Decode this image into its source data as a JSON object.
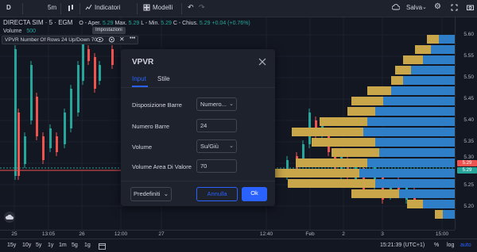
{
  "topbar": {
    "logo": "D",
    "interval": "5m",
    "indicators_label": "Indicatori",
    "templates_label": "Modelli",
    "save_label": "Salva"
  },
  "legend": {
    "symbol": "DIRECTA SIM · 5 · EGM",
    "open_label": "O - Aper.",
    "open_value": "5.29",
    "high_label": "Max.",
    "high_value": "5.29",
    "low_label": "L - Min.",
    "low_value": "5.29",
    "close_label": "C - Chius.",
    "close_value": "5.29",
    "change": "+0.04 (+0.76%)",
    "volume_label": "Volume",
    "volume_value": "500"
  },
  "indicator": {
    "text": "VPVR Number Of Rows 24 Up/Down 70",
    "tooltip": "Impostazioni"
  },
  "dialog": {
    "title": "VPVR",
    "tabs": [
      "Input",
      "Stile"
    ],
    "rows": [
      {
        "label": "Disposizione Barre",
        "value": "Numero..."
      },
      {
        "label": "Numero Barre",
        "value": "24"
      },
      {
        "label": "Volume",
        "value": "Su/Giù"
      },
      {
        "label": "Volume Area Di Valore",
        "value": "70"
      }
    ],
    "defaults_label": "Predefiniti",
    "cancel_label": "Annulla",
    "ok_label": "Ok"
  },
  "price_axis": {
    "labels": [
      "5.60",
      "5.55",
      "5.50",
      "5.45",
      "5.40",
      "5.35",
      "5.30",
      "5.25",
      "5.20"
    ],
    "badge_1": "5.29",
    "badge_2": "5.29"
  },
  "time_axis": {
    "labels": [
      "25",
      "13:05",
      "26",
      "12:00",
      "27",
      "12:40",
      "Feb",
      "2",
      "3",
      "15:00"
    ]
  },
  "bottom_bar": {
    "ranges": [
      "15y",
      "10y",
      "5y",
      "1y",
      "1m",
      "5g",
      "1g"
    ],
    "time": "15:21:39 (UTC+1)",
    "percent": "%",
    "log": "log",
    "auto": "auto"
  },
  "colors": {
    "up": "#26a69a",
    "down": "#ef5350",
    "vp_up": "#2f7fc8",
    "vp_down": "#c9a64a",
    "accent": "#2962ff"
  }
}
